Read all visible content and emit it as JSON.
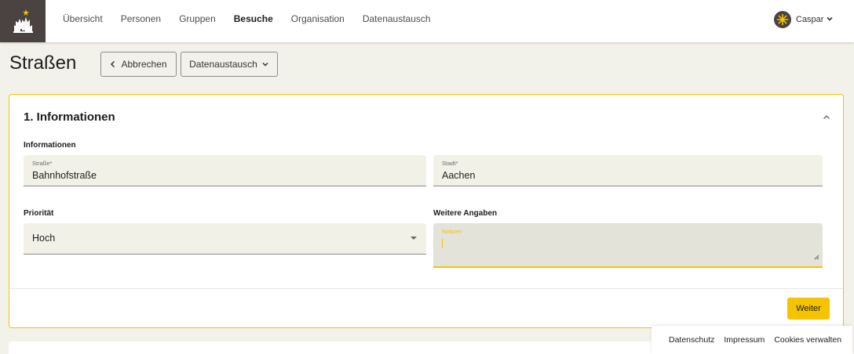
{
  "nav": {
    "items": [
      {
        "label": "Übersicht",
        "active": false
      },
      {
        "label": "Personen",
        "active": false
      },
      {
        "label": "Gruppen",
        "active": false
      },
      {
        "label": "Besuche",
        "active": true
      },
      {
        "label": "Organisation",
        "active": false
      },
      {
        "label": "Datenaustausch",
        "active": false
      }
    ],
    "user": {
      "name": "Caspar",
      "avatar_icon": "star-avatar-icon"
    },
    "logo_icon": "three-kings-logo"
  },
  "page": {
    "title": "Straßen",
    "cancel_label": "Abbrechen",
    "exchange_label": "Datenaustausch"
  },
  "form": {
    "section_title": "1. Informationen",
    "info_label": "Informationen",
    "street": {
      "label": "Straße*",
      "value": "Bahnhofstraße"
    },
    "city": {
      "label": "Stadt*",
      "value": "Aachen"
    },
    "priority_label": "Priorität",
    "priority_value": "Hoch",
    "more_label": "Weitere Angaben",
    "notes_label": "Notizen",
    "notes_value": "",
    "next_label": "Weiter"
  },
  "footer": {
    "links": [
      "Datenschutz",
      "Impressum",
      "Cookies verwalten"
    ]
  },
  "colors": {
    "accent": "#f5c400",
    "header_dark": "#4a4341",
    "page_bg": "#f3f2ea",
    "field_bg": "#f2f1e8"
  }
}
